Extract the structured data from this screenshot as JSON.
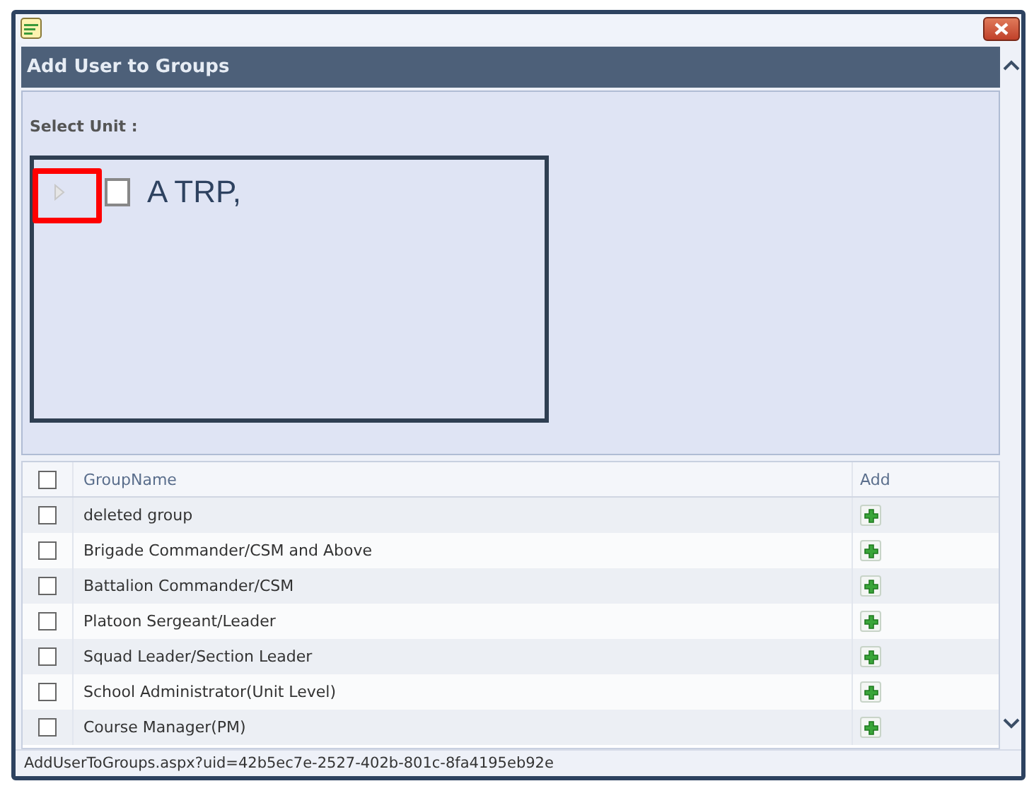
{
  "dialog": {
    "title": "Add User to Groups"
  },
  "unit_selector": {
    "label": "Select Unit :",
    "tree": [
      {
        "label": "A TRP,",
        "checked": false,
        "expanded": false
      }
    ]
  },
  "groups_table": {
    "select_all_checked": false,
    "columns": [
      "GroupName",
      "Add"
    ],
    "rows": [
      {
        "name": "deleted group",
        "checked": false
      },
      {
        "name": "Brigade Commander/CSM and Above",
        "checked": false
      },
      {
        "name": "Battalion Commander/CSM",
        "checked": false
      },
      {
        "name": "Platoon Sergeant/Leader",
        "checked": false
      },
      {
        "name": "Squad Leader/Section Leader",
        "checked": false
      },
      {
        "name": "School Administrator(Unit Level)",
        "checked": false
      },
      {
        "name": "Course Manager(PM)",
        "checked": false
      }
    ]
  },
  "status_bar": "AddUserToGroups.aspx?uid=42b5ec7e-2527-402b-801c-8fa4195eb92e"
}
